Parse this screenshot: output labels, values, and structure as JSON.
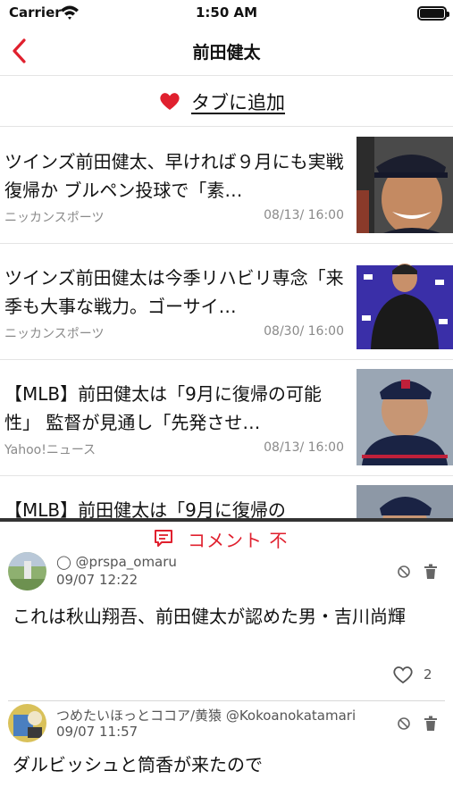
{
  "status": {
    "carrier": "Carrier",
    "time": "1:50 AM",
    "battery_level": 1.0
  },
  "nav": {
    "title": "前田健太"
  },
  "add_tab": {
    "label": "タブに追加",
    "icon": "heart-icon",
    "icon_color": "#e0202e"
  },
  "news": [
    {
      "headline": "ツインズ前田健太、早ければ９月にも実戦復帰か ブルペン投球で「素…",
      "source": "ニッカンスポーツ",
      "date": "08/13/ 16:00"
    },
    {
      "headline": "ツインズ前田健太は今季リハビリ専念「来季も大事な戦力。ゴーサイ…",
      "source": "ニッカンスポーツ",
      "date": "08/30/ 16:00"
    },
    {
      "headline": "【MLB】前田健太は「9月に復帰の可能性」 監督が見通し「先発させ…",
      "source": "Yahoo!ニュース",
      "date": "08/13/ 16:00"
    },
    {
      "headline": "【MLB】前田健太は「9月に復帰の",
      "source": "",
      "date": ""
    }
  ],
  "comment_bar": {
    "label": "コメント 不",
    "icon": "comment-icon",
    "accent": "#e0202e"
  },
  "comments": [
    {
      "user": "◯ @prspa_omaru",
      "time": "09/07 12:22",
      "body": "これは秋山翔吾、前田健太が認めた男・吉川尚輝",
      "likes": "2"
    },
    {
      "user": "つめたいほっとココア/黄猿 @Kokoanokatamari",
      "time": "09/07 11:57",
      "body": "ダルビッシュと筒香が来たので",
      "likes": ""
    }
  ]
}
